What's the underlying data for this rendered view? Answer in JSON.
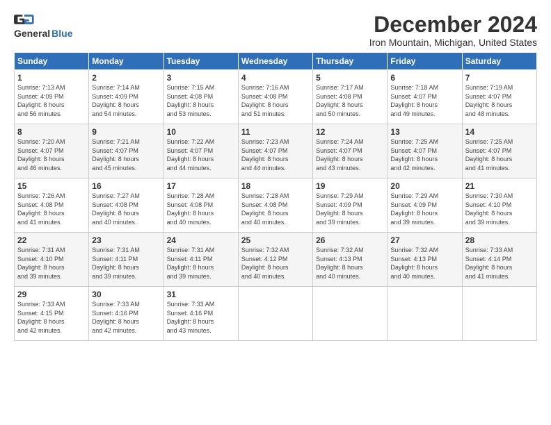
{
  "header": {
    "logo_general": "General",
    "logo_blue": "Blue",
    "title": "December 2024",
    "subtitle": "Iron Mountain, Michigan, United States"
  },
  "weekdays": [
    "Sunday",
    "Monday",
    "Tuesday",
    "Wednesday",
    "Thursday",
    "Friday",
    "Saturday"
  ],
  "weeks": [
    [
      {
        "day": "1",
        "lines": [
          "Sunrise: 7:13 AM",
          "Sunset: 4:09 PM",
          "Daylight: 8 hours",
          "and 56 minutes."
        ]
      },
      {
        "day": "2",
        "lines": [
          "Sunrise: 7:14 AM",
          "Sunset: 4:09 PM",
          "Daylight: 8 hours",
          "and 54 minutes."
        ]
      },
      {
        "day": "3",
        "lines": [
          "Sunrise: 7:15 AM",
          "Sunset: 4:08 PM",
          "Daylight: 8 hours",
          "and 53 minutes."
        ]
      },
      {
        "day": "4",
        "lines": [
          "Sunrise: 7:16 AM",
          "Sunset: 4:08 PM",
          "Daylight: 8 hours",
          "and 51 minutes."
        ]
      },
      {
        "day": "5",
        "lines": [
          "Sunrise: 7:17 AM",
          "Sunset: 4:08 PM",
          "Daylight: 8 hours",
          "and 50 minutes."
        ]
      },
      {
        "day": "6",
        "lines": [
          "Sunrise: 7:18 AM",
          "Sunset: 4:07 PM",
          "Daylight: 8 hours",
          "and 49 minutes."
        ]
      },
      {
        "day": "7",
        "lines": [
          "Sunrise: 7:19 AM",
          "Sunset: 4:07 PM",
          "Daylight: 8 hours",
          "and 48 minutes."
        ]
      }
    ],
    [
      {
        "day": "8",
        "lines": [
          "Sunrise: 7:20 AM",
          "Sunset: 4:07 PM",
          "Daylight: 8 hours",
          "and 46 minutes."
        ]
      },
      {
        "day": "9",
        "lines": [
          "Sunrise: 7:21 AM",
          "Sunset: 4:07 PM",
          "Daylight: 8 hours",
          "and 45 minutes."
        ]
      },
      {
        "day": "10",
        "lines": [
          "Sunrise: 7:22 AM",
          "Sunset: 4:07 PM",
          "Daylight: 8 hours",
          "and 44 minutes."
        ]
      },
      {
        "day": "11",
        "lines": [
          "Sunrise: 7:23 AM",
          "Sunset: 4:07 PM",
          "Daylight: 8 hours",
          "and 44 minutes."
        ]
      },
      {
        "day": "12",
        "lines": [
          "Sunrise: 7:24 AM",
          "Sunset: 4:07 PM",
          "Daylight: 8 hours",
          "and 43 minutes."
        ]
      },
      {
        "day": "13",
        "lines": [
          "Sunrise: 7:25 AM",
          "Sunset: 4:07 PM",
          "Daylight: 8 hours",
          "and 42 minutes."
        ]
      },
      {
        "day": "14",
        "lines": [
          "Sunrise: 7:25 AM",
          "Sunset: 4:07 PM",
          "Daylight: 8 hours",
          "and 41 minutes."
        ]
      }
    ],
    [
      {
        "day": "15",
        "lines": [
          "Sunrise: 7:26 AM",
          "Sunset: 4:08 PM",
          "Daylight: 8 hours",
          "and 41 minutes."
        ]
      },
      {
        "day": "16",
        "lines": [
          "Sunrise: 7:27 AM",
          "Sunset: 4:08 PM",
          "Daylight: 8 hours",
          "and 40 minutes."
        ]
      },
      {
        "day": "17",
        "lines": [
          "Sunrise: 7:28 AM",
          "Sunset: 4:08 PM",
          "Daylight: 8 hours",
          "and 40 minutes."
        ]
      },
      {
        "day": "18",
        "lines": [
          "Sunrise: 7:28 AM",
          "Sunset: 4:08 PM",
          "Daylight: 8 hours",
          "and 40 minutes."
        ]
      },
      {
        "day": "19",
        "lines": [
          "Sunrise: 7:29 AM",
          "Sunset: 4:09 PM",
          "Daylight: 8 hours",
          "and 39 minutes."
        ]
      },
      {
        "day": "20",
        "lines": [
          "Sunrise: 7:29 AM",
          "Sunset: 4:09 PM",
          "Daylight: 8 hours",
          "and 39 minutes."
        ]
      },
      {
        "day": "21",
        "lines": [
          "Sunrise: 7:30 AM",
          "Sunset: 4:10 PM",
          "Daylight: 8 hours",
          "and 39 minutes."
        ]
      }
    ],
    [
      {
        "day": "22",
        "lines": [
          "Sunrise: 7:31 AM",
          "Sunset: 4:10 PM",
          "Daylight: 8 hours",
          "and 39 minutes."
        ]
      },
      {
        "day": "23",
        "lines": [
          "Sunrise: 7:31 AM",
          "Sunset: 4:11 PM",
          "Daylight: 8 hours",
          "and 39 minutes."
        ]
      },
      {
        "day": "24",
        "lines": [
          "Sunrise: 7:31 AM",
          "Sunset: 4:11 PM",
          "Daylight: 8 hours",
          "and 39 minutes."
        ]
      },
      {
        "day": "25",
        "lines": [
          "Sunrise: 7:32 AM",
          "Sunset: 4:12 PM",
          "Daylight: 8 hours",
          "and 40 minutes."
        ]
      },
      {
        "day": "26",
        "lines": [
          "Sunrise: 7:32 AM",
          "Sunset: 4:13 PM",
          "Daylight: 8 hours",
          "and 40 minutes."
        ]
      },
      {
        "day": "27",
        "lines": [
          "Sunrise: 7:32 AM",
          "Sunset: 4:13 PM",
          "Daylight: 8 hours",
          "and 40 minutes."
        ]
      },
      {
        "day": "28",
        "lines": [
          "Sunrise: 7:33 AM",
          "Sunset: 4:14 PM",
          "Daylight: 8 hours",
          "and 41 minutes."
        ]
      }
    ],
    [
      {
        "day": "29",
        "lines": [
          "Sunrise: 7:33 AM",
          "Sunset: 4:15 PM",
          "Daylight: 8 hours",
          "and 42 minutes."
        ]
      },
      {
        "day": "30",
        "lines": [
          "Sunrise: 7:33 AM",
          "Sunset: 4:16 PM",
          "Daylight: 8 hours",
          "and 42 minutes."
        ]
      },
      {
        "day": "31",
        "lines": [
          "Sunrise: 7:33 AM",
          "Sunset: 4:16 PM",
          "Daylight: 8 hours",
          "and 43 minutes."
        ]
      },
      null,
      null,
      null,
      null
    ]
  ]
}
